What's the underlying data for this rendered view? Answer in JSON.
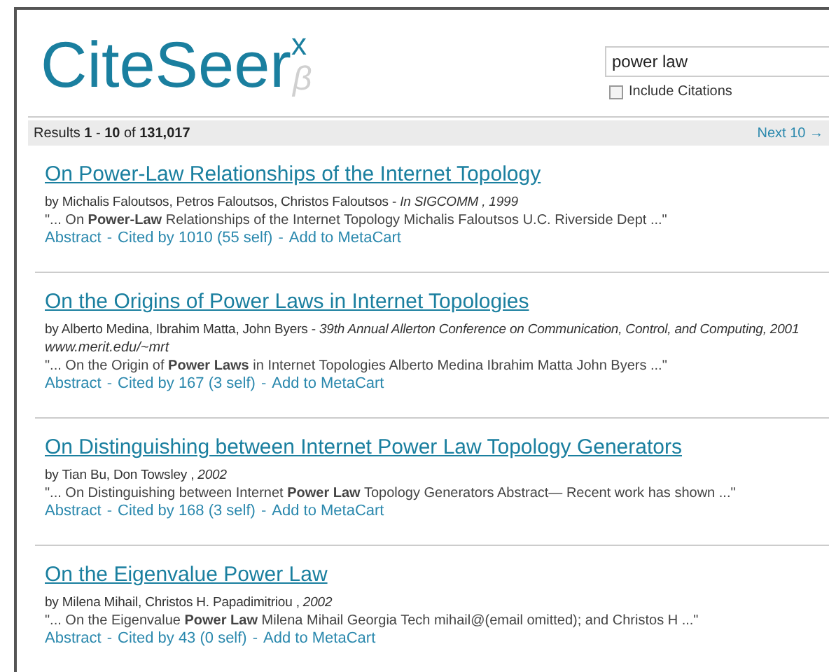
{
  "logo": {
    "name": "CiteSeer",
    "sup": "x",
    "sub": "β"
  },
  "search": {
    "value": "power law",
    "include_citations": {
      "label": "Include Citations",
      "checked": false
    }
  },
  "results_bar": {
    "summary": "Results **1** - **10** of **131,017**",
    "next": "Next 10 →"
  },
  "results": [
    {
      "title": "On Power-Law Relationships of the Internet Topology",
      "byline": "by Michalis Faloutsos, Petros Faloutsos, Christos Faloutsos - *In SIGCOMM , 1999*",
      "snippet": "\"... On **Power-Law** Relationships of the Internet Topology Michalis Faloutsos U.C. Riverside Dept ...\"",
      "links": [
        {
          "kind": "link",
          "text": "Abstract"
        },
        {
          "kind": "separator",
          "text": "-"
        },
        {
          "kind": "link",
          "text": "Cited by 1010 (55 self)"
        },
        {
          "kind": "separator",
          "text": "-"
        },
        {
          "kind": "link",
          "text": "Add to MetaCart"
        }
      ]
    },
    {
      "title": "On the Origins of Power Laws in Internet Topologies",
      "byline": "by Alberto Medina, Ibrahim Matta, John Byers - *39th Annual Allerton Conference on Communication, Control, and Computing, 2001*",
      "url": "www.merit.edu/~mrt",
      "snippet": "\"... On the Origin of **Power Laws** in Internet Topologies Alberto Medina Ibrahim Matta John Byers ...\"",
      "links": [
        {
          "kind": "link",
          "text": "Abstract"
        },
        {
          "kind": "separator",
          "text": "-"
        },
        {
          "kind": "link",
          "text": "Cited by 167 (3 self)"
        },
        {
          "kind": "separator",
          "text": "-"
        },
        {
          "kind": "link",
          "text": "Add to MetaCart"
        }
      ]
    },
    {
      "title": "On Distinguishing between Internet Power Law Topology Generators",
      "byline": "by Tian Bu, Don Towsley , *2002*",
      "snippet": "\"... On Distinguishing between Internet **Power Law** Topology Generators Abstract— Recent work has shown ...\"",
      "links": [
        {
          "kind": "link",
          "text": "Abstract"
        },
        {
          "kind": "separator",
          "text": "-"
        },
        {
          "kind": "link",
          "text": "Cited by 168 (3 self)"
        },
        {
          "kind": "separator",
          "text": "-"
        },
        {
          "kind": "link",
          "text": "Add to MetaCart"
        }
      ]
    },
    {
      "title": "On the Eigenvalue Power Law",
      "byline": "by Milena Mihail, Christos H. Papadimitriou , *2002*",
      "snippet": "\"... On the Eigenvalue **Power Law** Milena Mihail Georgia Tech mihail@(email omitted); and Christos H ...\"",
      "links": [
        {
          "kind": "link",
          "text": "Abstract"
        },
        {
          "kind": "separator",
          "text": "-"
        },
        {
          "kind": "link",
          "text": "Cited by 43 (0 self)"
        },
        {
          "kind": "separator",
          "text": "-"
        },
        {
          "kind": "link",
          "text": "Add to MetaCart"
        }
      ]
    }
  ]
}
